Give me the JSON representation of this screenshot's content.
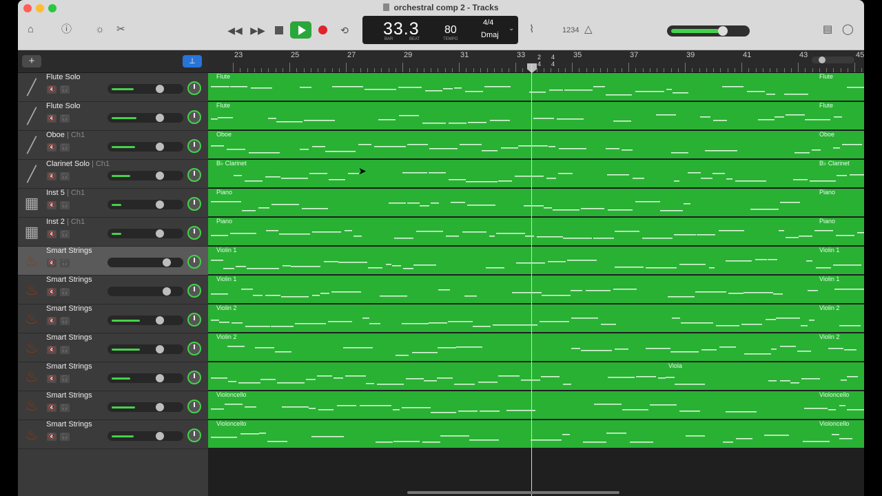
{
  "window": {
    "title": "orchestral comp 2 - Tracks"
  },
  "toolbar": {
    "left_icons": [
      "library-icon",
      "help-icon",
      "smart-controls-icon",
      "scissors-icon"
    ],
    "transport_icons": [
      "rewind-icon",
      "fast-forward-icon",
      "stop-icon",
      "play-icon",
      "record-icon",
      "cycle-icon"
    ],
    "right_icons": [
      "tuner-icon",
      "metronome-icon",
      "notepad-icon",
      "loops-icon"
    ],
    "count_in": "1234"
  },
  "lcd": {
    "bar": "33.3",
    "bar_label": "BAR",
    "beat_label": "BEAT",
    "tempo": "80",
    "tempo_label": "TEMPO",
    "time_signature": "4/4",
    "key": "Dmaj"
  },
  "master_volume": {
    "level": 0.6
  },
  "ruler": {
    "bars": [
      "23",
      "25",
      "27",
      "29",
      "31",
      "33",
      "35",
      "37",
      "39",
      "41",
      "43",
      "45"
    ],
    "sig_marker_1": "2\n4",
    "sig_marker_2": "4\n4"
  },
  "header": {
    "add_label": "+",
    "snap_label": "⊥"
  },
  "tracks": [
    {
      "name": "Flute Solo",
      "channel": "",
      "icon": "flute-icon",
      "volume": 0.35,
      "region": "Flute",
      "end_label": "Flute"
    },
    {
      "name": "Flute Solo",
      "channel": "",
      "icon": "flute-icon",
      "volume": 0.4,
      "region": "Flute",
      "end_label": "Flute"
    },
    {
      "name": "Oboe",
      "channel": "| Ch1",
      "icon": "oboe-icon",
      "volume": 0.38,
      "region": "Oboe",
      "end_label": "Oboe"
    },
    {
      "name": "Clarinet Solo",
      "channel": "| Ch1",
      "icon": "clarinet-icon",
      "volume": 0.3,
      "region": "B♭ Clarinet",
      "end_label": "B♭ Clarinet"
    },
    {
      "name": "Inst 5",
      "channel": "| Ch1",
      "icon": "piano-icon",
      "volume": 0.15,
      "region": "Piano",
      "end_label": "Piano"
    },
    {
      "name": "Inst 2",
      "channel": "| Ch1",
      "icon": "piano-icon",
      "volume": 0.15,
      "region": "Piano",
      "end_label": "Piano"
    },
    {
      "name": "Smart Strings",
      "channel": "",
      "icon": "strings-icon",
      "volume": 0.0,
      "region": "Violin 1",
      "end_label": "Violin 1",
      "selected": true
    },
    {
      "name": "Smart Strings",
      "channel": "",
      "icon": "strings-icon",
      "volume": 0.0,
      "region": "Violin 1",
      "end_label": "Violin 1"
    },
    {
      "name": "Smart Strings",
      "channel": "",
      "icon": "strings-icon",
      "volume": 0.45,
      "region": "Violin 2",
      "end_label": "Violin 2"
    },
    {
      "name": "Smart Strings",
      "channel": "",
      "icon": "strings-icon",
      "volume": 0.45,
      "region": "Violin 2",
      "end_label": "Violin 2"
    },
    {
      "name": "Smart Strings",
      "channel": "",
      "icon": "strings-icon",
      "volume": 0.3,
      "region": "",
      "end_label": "",
      "mid_label": "Viola"
    },
    {
      "name": "Smart Strings",
      "channel": "",
      "icon": "strings-icon",
      "volume": 0.38,
      "region": "Violoncello",
      "end_label": "Violoncello"
    },
    {
      "name": "Smart Strings",
      "channel": "",
      "icon": "strings-icon",
      "volume": 0.35,
      "region": "Violoncello",
      "end_label": "Violoncello"
    }
  ]
}
